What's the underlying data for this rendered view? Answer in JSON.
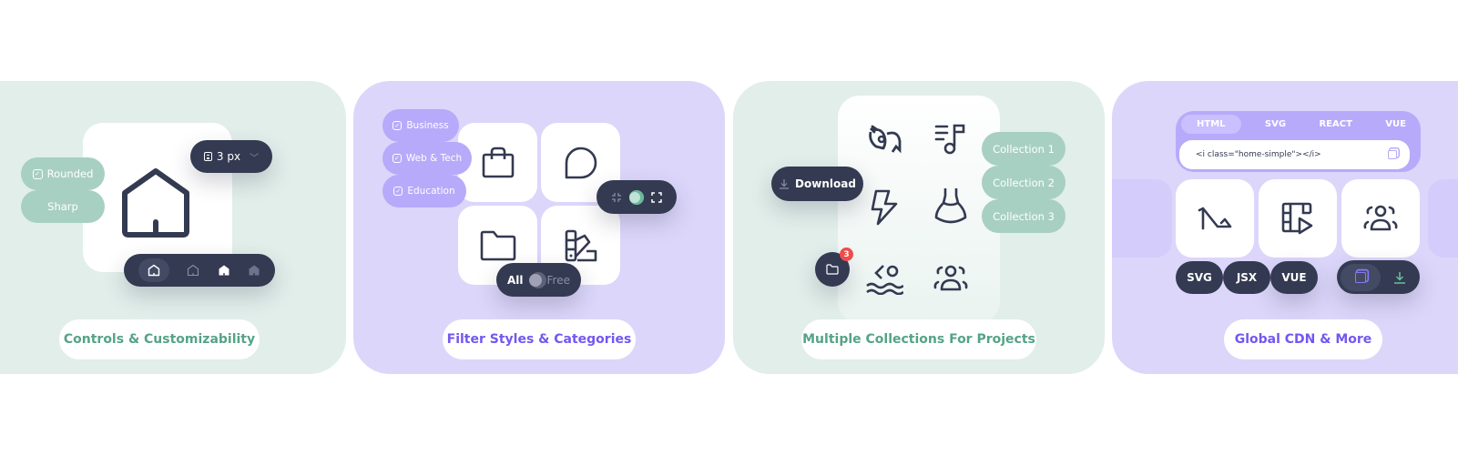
{
  "cards": [
    {
      "title": "Controls & Customizability",
      "styles": [
        "Rounded",
        "Sharp"
      ],
      "stroke_width": "3 px",
      "icon": "home-icon",
      "variants": [
        "home-outline-icon",
        "home-outline-thin-icon",
        "home-solid-icon",
        "home-solid-muted-icon"
      ]
    },
    {
      "title": "Filter Styles & Categories",
      "categories": [
        "Business",
        "Web & Tech",
        "Education"
      ],
      "icons": [
        "shopping-bag-icon",
        "chat-bubble-icon",
        "folder-icon",
        "color-swatch-icon"
      ],
      "toggle": {
        "left": "All",
        "right": "Free"
      }
    },
    {
      "title": "Multiple Collections For Projects",
      "download_label": "Download",
      "folder_badge": "3",
      "collections": [
        "Collection 1",
        "Collection 2",
        "Collection 3"
      ],
      "icons": [
        "sign-language-icon",
        "music-note-icon",
        "lightning-icon",
        "dress-icon",
        "swimming-icon",
        "group-icon"
      ]
    },
    {
      "title": "Global CDN & More",
      "tabs": [
        "HTML",
        "SVG",
        "REACT",
        "VUE"
      ],
      "active_tab": "HTML",
      "code": "<i class=\"home-simple\"></i>",
      "formats": [
        "SVG",
        "JSX",
        "VUE"
      ],
      "icons": [
        "high-heel-icon",
        "film-play-icon",
        "group-icon"
      ]
    }
  ],
  "colors": {
    "green_bg": "#e1eeea",
    "purple_bg": "#dcd6fb",
    "dark": "#333a51",
    "green_text": "#55a386",
    "purple_text": "#7357f0",
    "badge": "#ef4b4b"
  }
}
